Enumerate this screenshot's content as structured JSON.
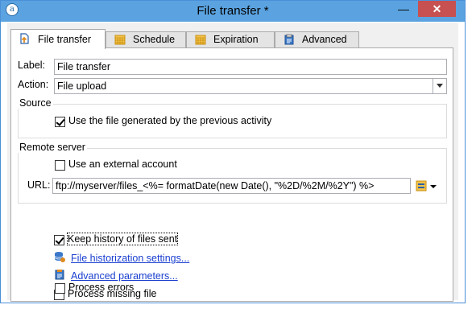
{
  "window": {
    "title": "File transfer *",
    "minimize_glyph": "—",
    "close_glyph": "✕"
  },
  "tabs": [
    {
      "label": "File transfer",
      "icon": "file-transfer-icon"
    },
    {
      "label": "Schedule",
      "icon": "calendar-icon"
    },
    {
      "label": "Expiration",
      "icon": "calendar-icon"
    },
    {
      "label": "Advanced",
      "icon": "clipboard-icon"
    }
  ],
  "form": {
    "label_caption": "Label:",
    "label_value": "File transfer",
    "action_caption": "Action:",
    "action_value": "File upload"
  },
  "source": {
    "title": "Source",
    "use_generated_file_label": "Use the file generated by the previous activity",
    "use_generated_file_checked": true
  },
  "remote_server": {
    "title": "Remote server",
    "external_account_label": "Use an external account",
    "external_account_checked": false,
    "url_caption": "URL:",
    "url_value": "ftp://myserver/files_<%= formatDate(new Date(), \"%2D/%2M/%2Y\") %>"
  },
  "options": {
    "keep_history_label": "Keep history of files sent",
    "keep_history_checked": true,
    "historization_link": "File historization settings...",
    "advanced_link": "Advanced parameters...",
    "process_missing_label": "Process missing file",
    "process_missing_checked": false,
    "process_errors_label": "Process errors",
    "process_errors_checked": false
  },
  "colors": {
    "titlebar": "#5ba3e0",
    "close_button": "#c75050",
    "link": "#1a3fd0"
  }
}
